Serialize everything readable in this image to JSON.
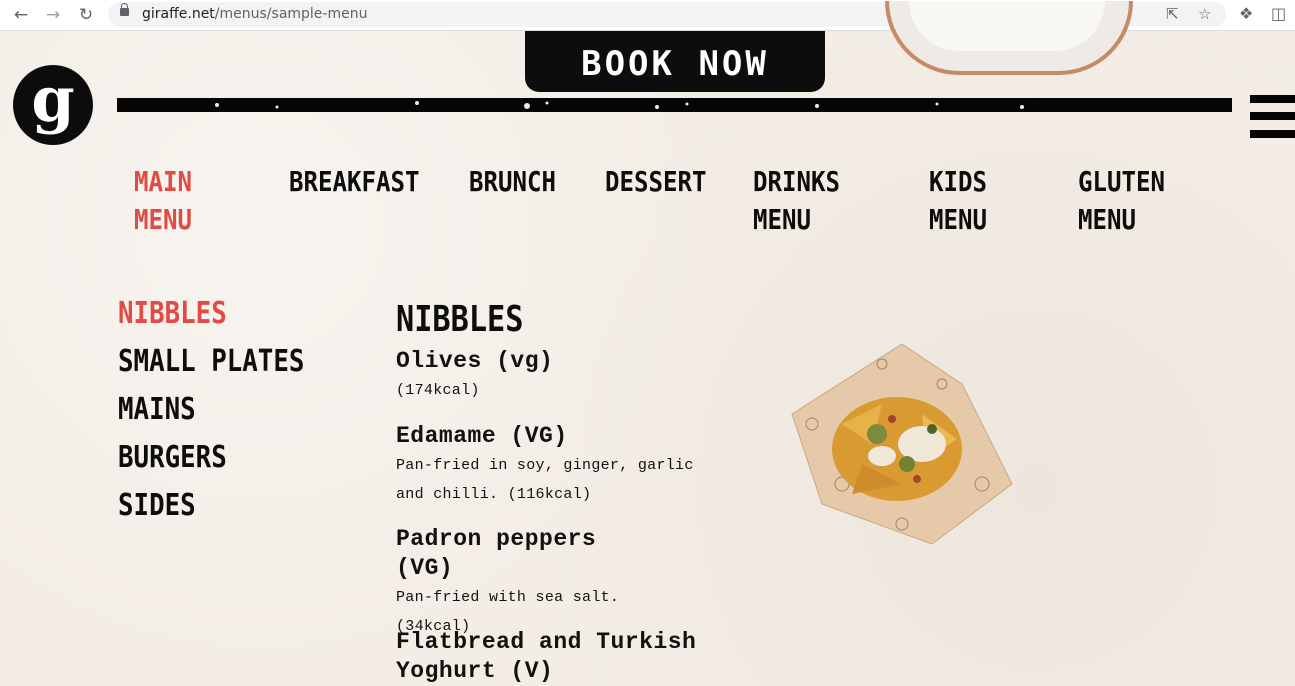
{
  "browser": {
    "url_domain": "giraffe.net",
    "url_path": "/menus/sample-menu",
    "back_icon": "arrow-left-icon",
    "forward_icon": "arrow-right-icon",
    "reload_icon": "reload-icon"
  },
  "header": {
    "logo_text": "g",
    "book_label": "BOOK NOW"
  },
  "menu_tabs": [
    {
      "label": "MAIN\nMENU",
      "active": true
    },
    {
      "label": "BREAKFAST",
      "active": false
    },
    {
      "label": "BRUNCH",
      "active": false
    },
    {
      "label": "DESSERT",
      "active": false
    },
    {
      "label": "DRINKS\nMENU",
      "active": false
    },
    {
      "label": "KIDS\nMENU",
      "active": false
    },
    {
      "label": "GLUTEN\nMENU",
      "active": false
    }
  ],
  "categories": [
    {
      "label": "NIBBLES",
      "active": true
    },
    {
      "label": "SMALL PLATES",
      "active": false
    },
    {
      "label": "MAINS",
      "active": false
    },
    {
      "label": "BURGERS",
      "active": false
    },
    {
      "label": "SIDES",
      "active": false
    }
  ],
  "section": {
    "title": "NIBBLES",
    "items": [
      {
        "name": "Olives (vg)",
        "desc": "(174kcal)"
      },
      {
        "name": "Edamame (VG)",
        "desc": "Pan-fried in soy, ginger, garlic and chilli. (116kcal)"
      },
      {
        "name": "Padron peppers (VG)",
        "desc": "Pan-fried with sea salt. (34kcal)"
      },
      {
        "name": "Flatbread and Turkish Yoghurt (V)",
        "desc": ""
      }
    ]
  },
  "colors": {
    "accent": "#e04b43",
    "background": "#f3ede6",
    "ink": "#0d0d0d"
  }
}
